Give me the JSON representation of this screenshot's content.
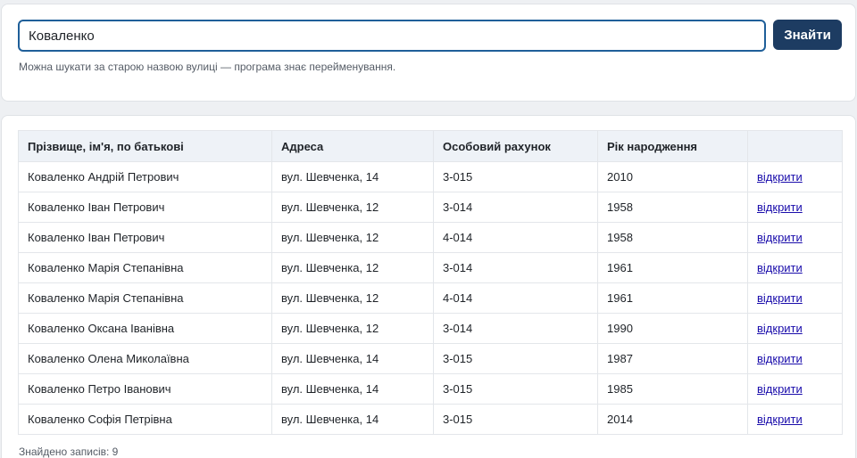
{
  "search": {
    "value": "Коваленко",
    "button_label": "Знайти",
    "hint": "Можна шукати за старою назвою вулиці — програма знає перейменування."
  },
  "table": {
    "headers": [
      "Прізвище, ім'я, по батькові",
      "Адреса",
      "Особовий рахунок",
      "Рік народження",
      ""
    ],
    "rows": [
      {
        "name": "Коваленко Андрій Петрович",
        "address": "вул. Шевченка, 14",
        "account": "3-015",
        "year": "2010",
        "action": "відкрити"
      },
      {
        "name": "Коваленко Іван Петрович",
        "address": "вул. Шевченка, 12",
        "account": "3-014",
        "year": "1958",
        "action": "відкрити"
      },
      {
        "name": "Коваленко Іван Петрович",
        "address": "вул. Шевченка, 12",
        "account": "4-014",
        "year": "1958",
        "action": "відкрити"
      },
      {
        "name": "Коваленко Марія Степанівна",
        "address": "вул. Шевченка, 12",
        "account": "3-014",
        "year": "1961",
        "action": "відкрити"
      },
      {
        "name": "Коваленко Марія Степанівна",
        "address": "вул. Шевченка, 12",
        "account": "4-014",
        "year": "1961",
        "action": "відкрити"
      },
      {
        "name": "Коваленко Оксана Іванівна",
        "address": "вул. Шевченка, 12",
        "account": "3-014",
        "year": "1990",
        "action": "відкрити"
      },
      {
        "name": "Коваленко Олена Миколаївна",
        "address": "вул. Шевченка, 14",
        "account": "3-015",
        "year": "1987",
        "action": "відкрити"
      },
      {
        "name": "Коваленко Петро Іванович",
        "address": "вул. Шевченка, 14",
        "account": "3-015",
        "year": "1985",
        "action": "відкрити"
      },
      {
        "name": "Коваленко Софія Петрівна",
        "address": "вул. Шевченка, 14",
        "account": "3-015",
        "year": "2014",
        "action": "відкрити"
      }
    ]
  },
  "footer": {
    "count_text": "Знайдено записів: 9"
  },
  "colors": {
    "accent": "#1d3c62",
    "input_border": "#1f5f99",
    "link": "#1a0dab",
    "header_bg": "#eef2f7"
  }
}
